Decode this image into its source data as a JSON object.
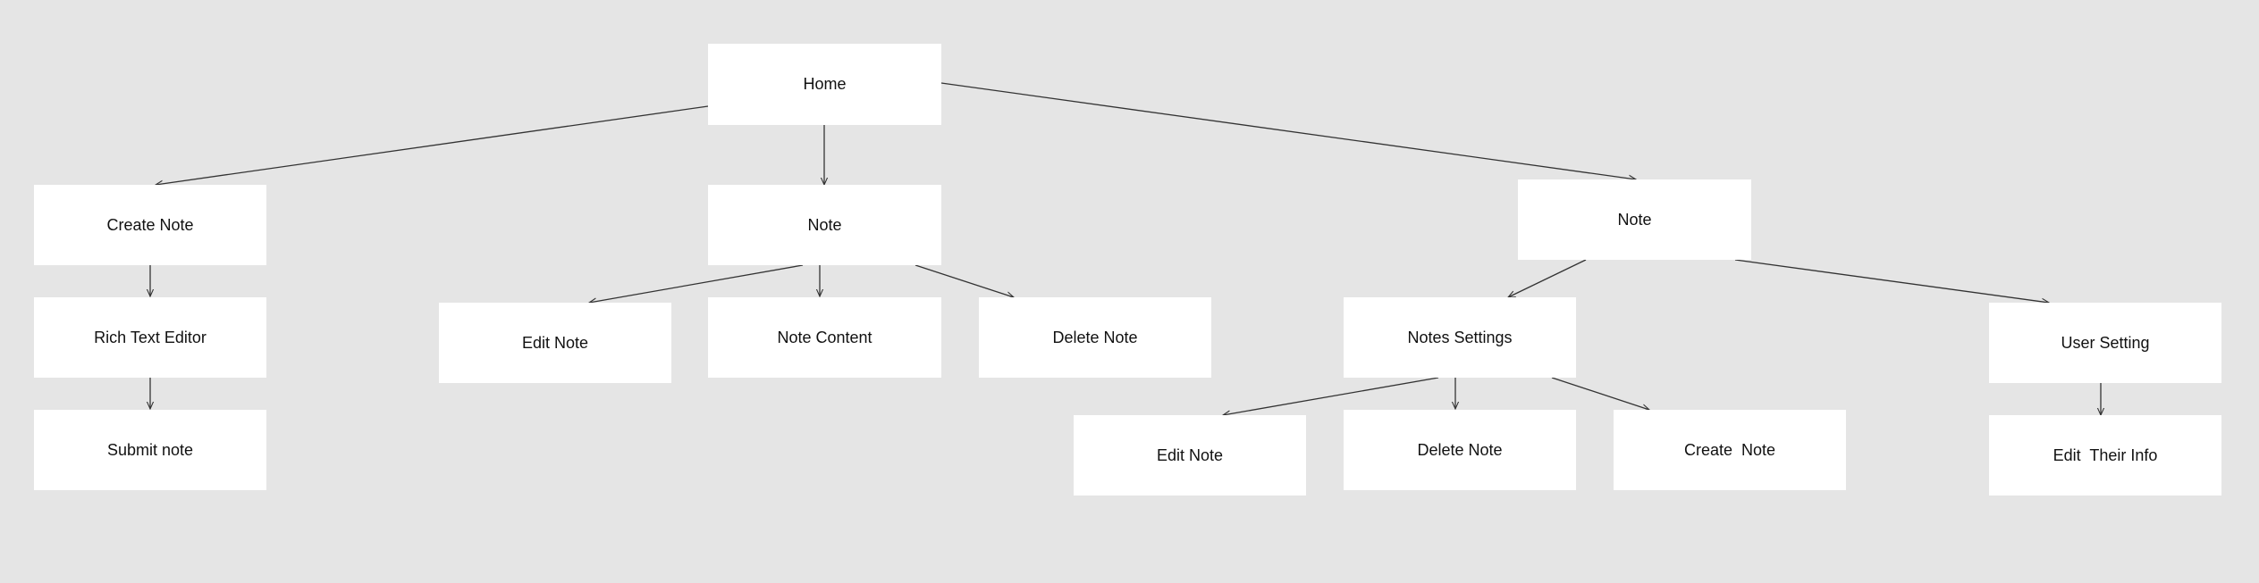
{
  "colors": {
    "background": "#e5e5e5",
    "node_fill": "#ffffff",
    "edge": "#333333",
    "text": "#111111"
  },
  "nodes": {
    "home": "Home",
    "create_note": "Create Note",
    "note_mid": "Note",
    "note_right": "Note",
    "rich_text_editor": "Rich Text Editor",
    "submit_note": "Submit note",
    "edit_note_1": "Edit Note",
    "note_content": "Note Content",
    "delete_note_1": "Delete Note",
    "notes_settings": "Notes Settings",
    "user_setting": "User Setting",
    "edit_note_2": "Edit Note",
    "delete_note_2": "Delete Note",
    "create_note_2": "Create  Note",
    "edit_their_info": "Edit  Their Info"
  }
}
